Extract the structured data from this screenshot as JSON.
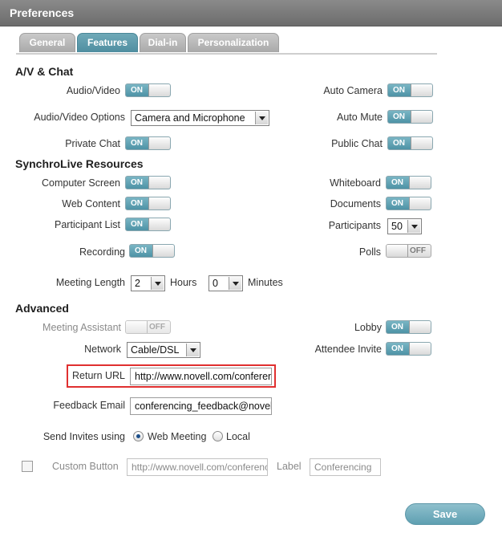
{
  "title": "Preferences",
  "tabs": {
    "general": "General",
    "features": "Features",
    "dialin": "Dial-in",
    "personalization": "Personalization"
  },
  "sections": {
    "av_chat": "A/V & Chat",
    "synchrolive": "SynchroLive Resources",
    "advanced": "Advanced"
  },
  "on_text": "ON",
  "off_text": "OFF",
  "av": {
    "audio_video": "Audio/Video",
    "audio_video_options": "Audio/Video Options",
    "audio_video_options_value": "Camera and Microphone",
    "private_chat": "Private Chat",
    "auto_camera": "Auto Camera",
    "auto_mute": "Auto Mute",
    "public_chat": "Public Chat"
  },
  "resources": {
    "computer_screen": "Computer Screen",
    "web_content": "Web Content",
    "participant_list": "Participant List",
    "recording": "Recording",
    "whiteboard": "Whiteboard",
    "documents": "Documents",
    "participants": "Participants",
    "participants_value": "50",
    "polls": "Polls",
    "meeting_length": "Meeting Length",
    "hours_value": "2",
    "hours": "Hours",
    "minutes_value": "0",
    "minutes": "Minutes"
  },
  "advanced": {
    "meeting_assistant": "Meeting Assistant",
    "network": "Network",
    "network_value": "Cable/DSL",
    "lobby": "Lobby",
    "attendee_invite": "Attendee Invite",
    "return_url": "Return URL",
    "return_url_value": "http://www.novell.com/conferencing",
    "feedback_email": "Feedback Email",
    "feedback_email_value": "conferencing_feedback@novell.com",
    "send_invites": "Send Invites using",
    "web_meeting": "Web Meeting",
    "local": "Local",
    "custom_button": "Custom Button",
    "custom_button_url": "http://www.novell.com/conferencing",
    "label": "Label",
    "label_value": "Conferencing"
  },
  "save": "Save"
}
